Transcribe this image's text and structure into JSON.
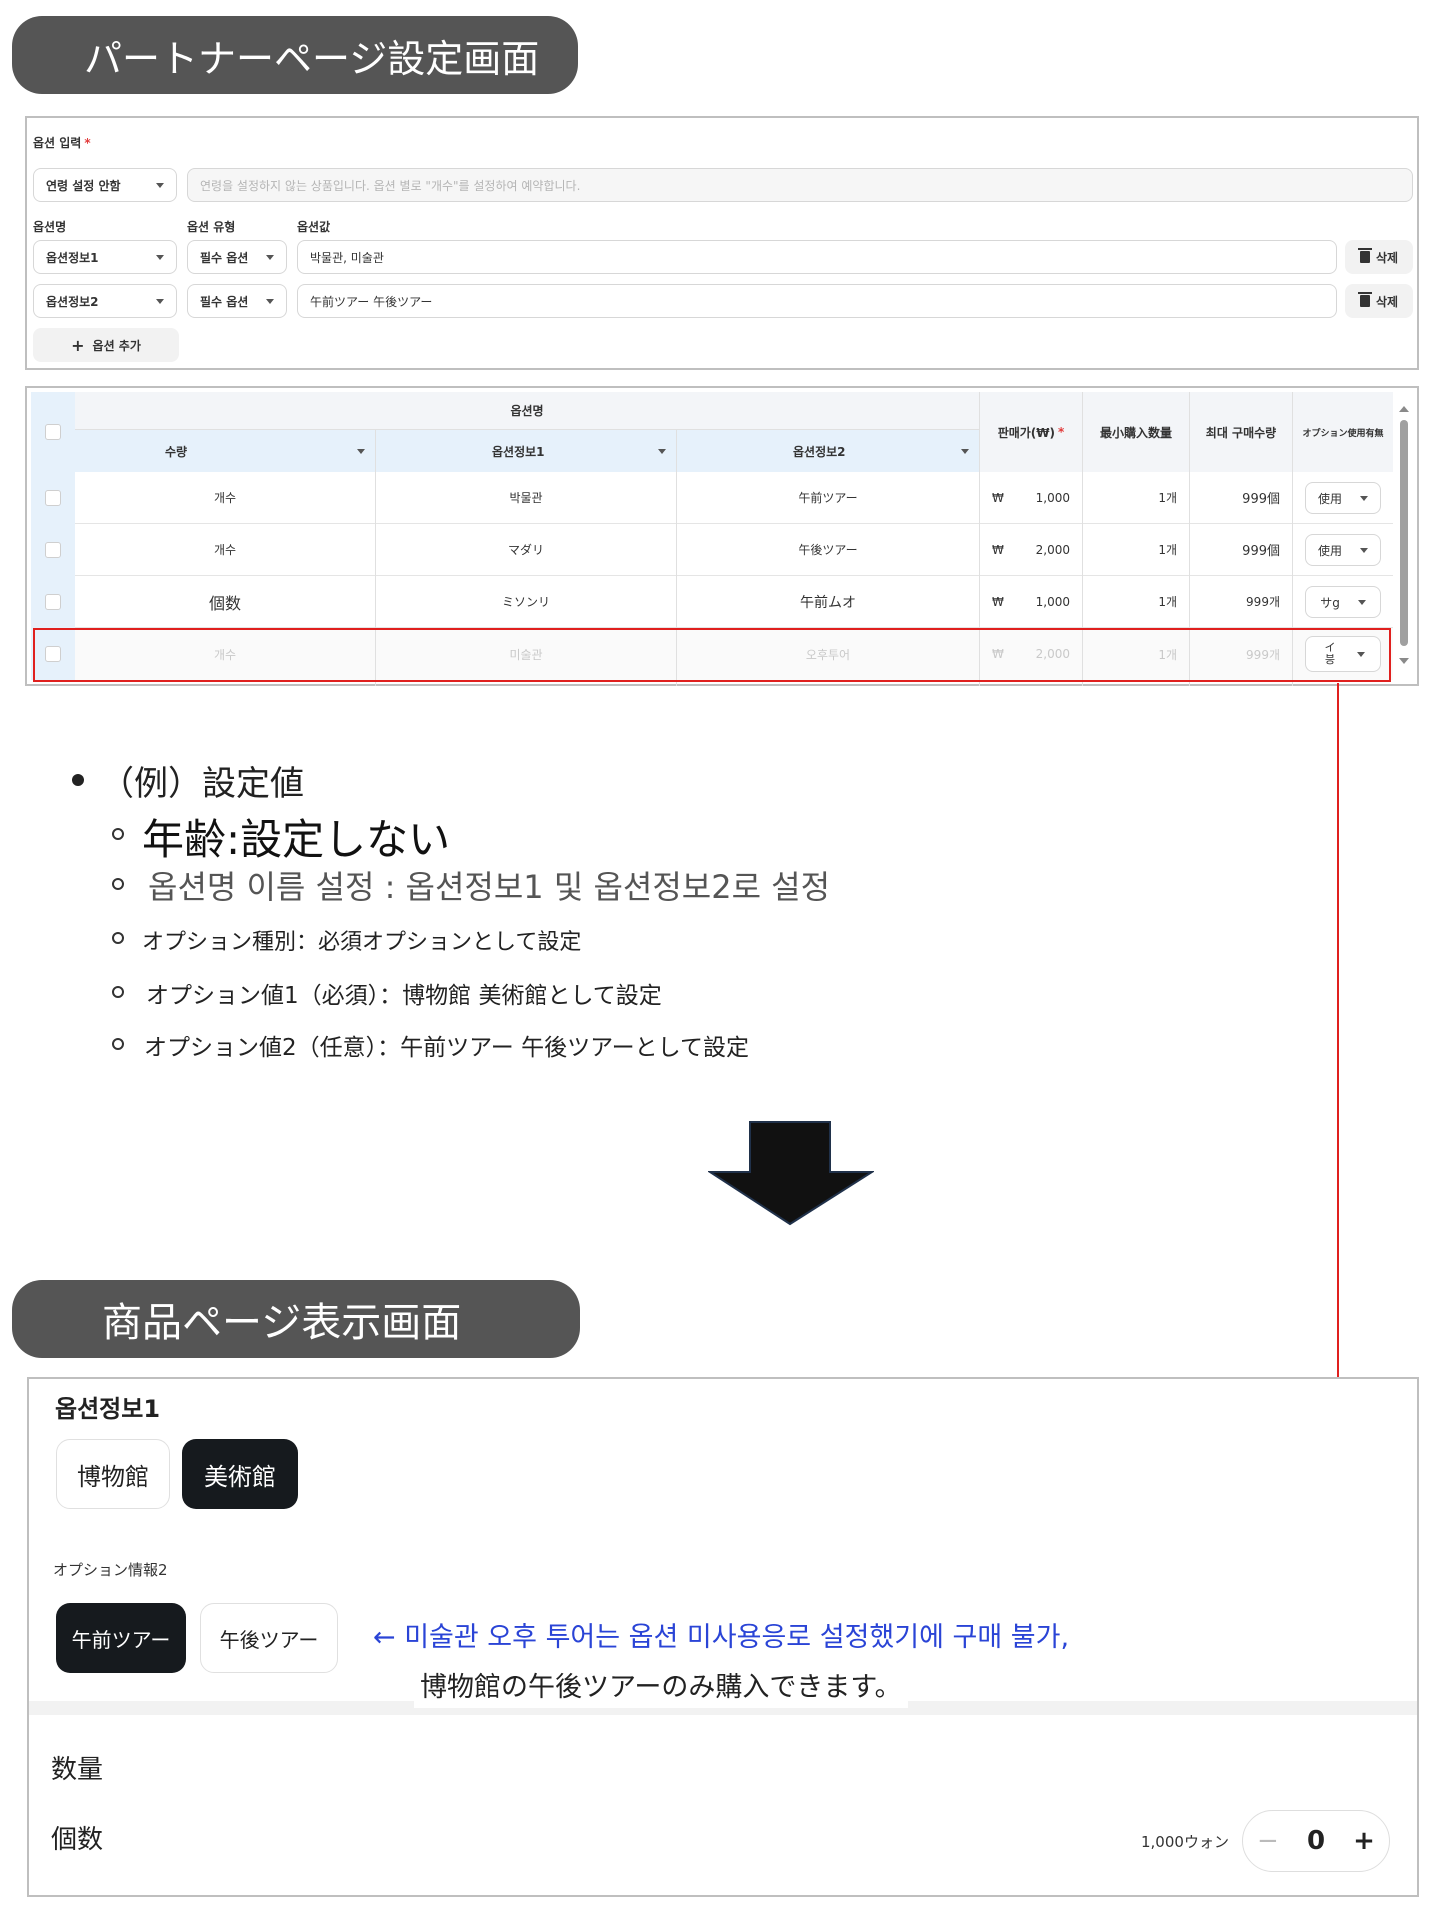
{
  "partner_title": "パートナーページ設定画面",
  "option_form": {
    "label": "옵션 입력",
    "required_mark": "*",
    "age_select": "연령 설정 안함",
    "age_notice": "연령을 설정하지 않는 상품입니다. 옵션 별로 \"개수\"를 설정하여 예약합니다.",
    "col_name": "옵션명",
    "col_type": "옵션 유형",
    "col_value": "옵션값",
    "rows": [
      {
        "name": "옵션정보1",
        "type": "필수 옵션",
        "value": "박물관, 미술관",
        "delete": "삭제"
      },
      {
        "name": "옵션정보2",
        "type": "필수 옵션",
        "value": "午前ツアー 午後ツアー",
        "delete": "삭제"
      }
    ],
    "add_button": "옵션 추가"
  },
  "option_table": {
    "group_header": "옵션명",
    "sub_headers": [
      "수량",
      "옵션정보1",
      "옵션정보2"
    ],
    "price_header": "판매가(₩)",
    "min_header": "最小購入数量",
    "max_header": "최대 구매수량",
    "use_header": "オプション使用有無",
    "rows": [
      {
        "qty": "개수",
        "opt1": "박물관",
        "opt2": "午前ツアー",
        "currency": "₩",
        "price": "1,000",
        "min": "1개",
        "max": "999個",
        "use": "使用"
      },
      {
        "qty": "개수",
        "opt1": "マダリ",
        "opt2": "午後ツアー",
        "currency": "₩",
        "price": "2,000",
        "min": "1개",
        "max": "999個",
        "use": "使用"
      },
      {
        "qty": "個数",
        "opt1": "ミソンリ",
        "opt2": "午前ムオ",
        "currency": "₩",
        "price": "1,000",
        "min": "1개",
        "max": "999개",
        "use": "サg"
      },
      {
        "qty": "개수",
        "opt1": "미술관",
        "opt2": "오후투어",
        "currency": "₩",
        "price": "2,000",
        "min": "1개",
        "max": "999개",
        "use": "イ 븡"
      }
    ]
  },
  "bullets": {
    "main": "（例）設定値",
    "items": [
      "年齢:設定しない",
      "옵션명 이름 설정 : 옵션정보1 및 옵션정보2로 설정",
      "オプション種別：必須オプションとして設定",
      "オプション値1（必須）：博物館 美術館として設定",
      "オプション値2（任意）：午前ツアー 午後ツアーとして設定"
    ]
  },
  "product_title": "商品ページ表示画面",
  "product": {
    "option1_label": "옵션정보1",
    "option1_choices": [
      "博物館",
      "美術館"
    ],
    "option2_label": "オプション情報2",
    "option2_choices": [
      "午前ツアー",
      "午後ツアー"
    ],
    "note_line1": "← 미술관 오후 투어는 옵션 미사용응로 설정했기에 구매 불가,",
    "note_line2": "博物館の午後ツアーのみ購入できます。",
    "quantity_label": "数量",
    "count_label": "個数",
    "price": "1,000ウォン",
    "minus": "−",
    "qty_value": "0",
    "plus": "+"
  },
  "colors": {
    "title_bg": "#555555",
    "highlight": "#e0201e",
    "note_blue": "#2a44d6",
    "chip_dark": "#161a1e"
  }
}
